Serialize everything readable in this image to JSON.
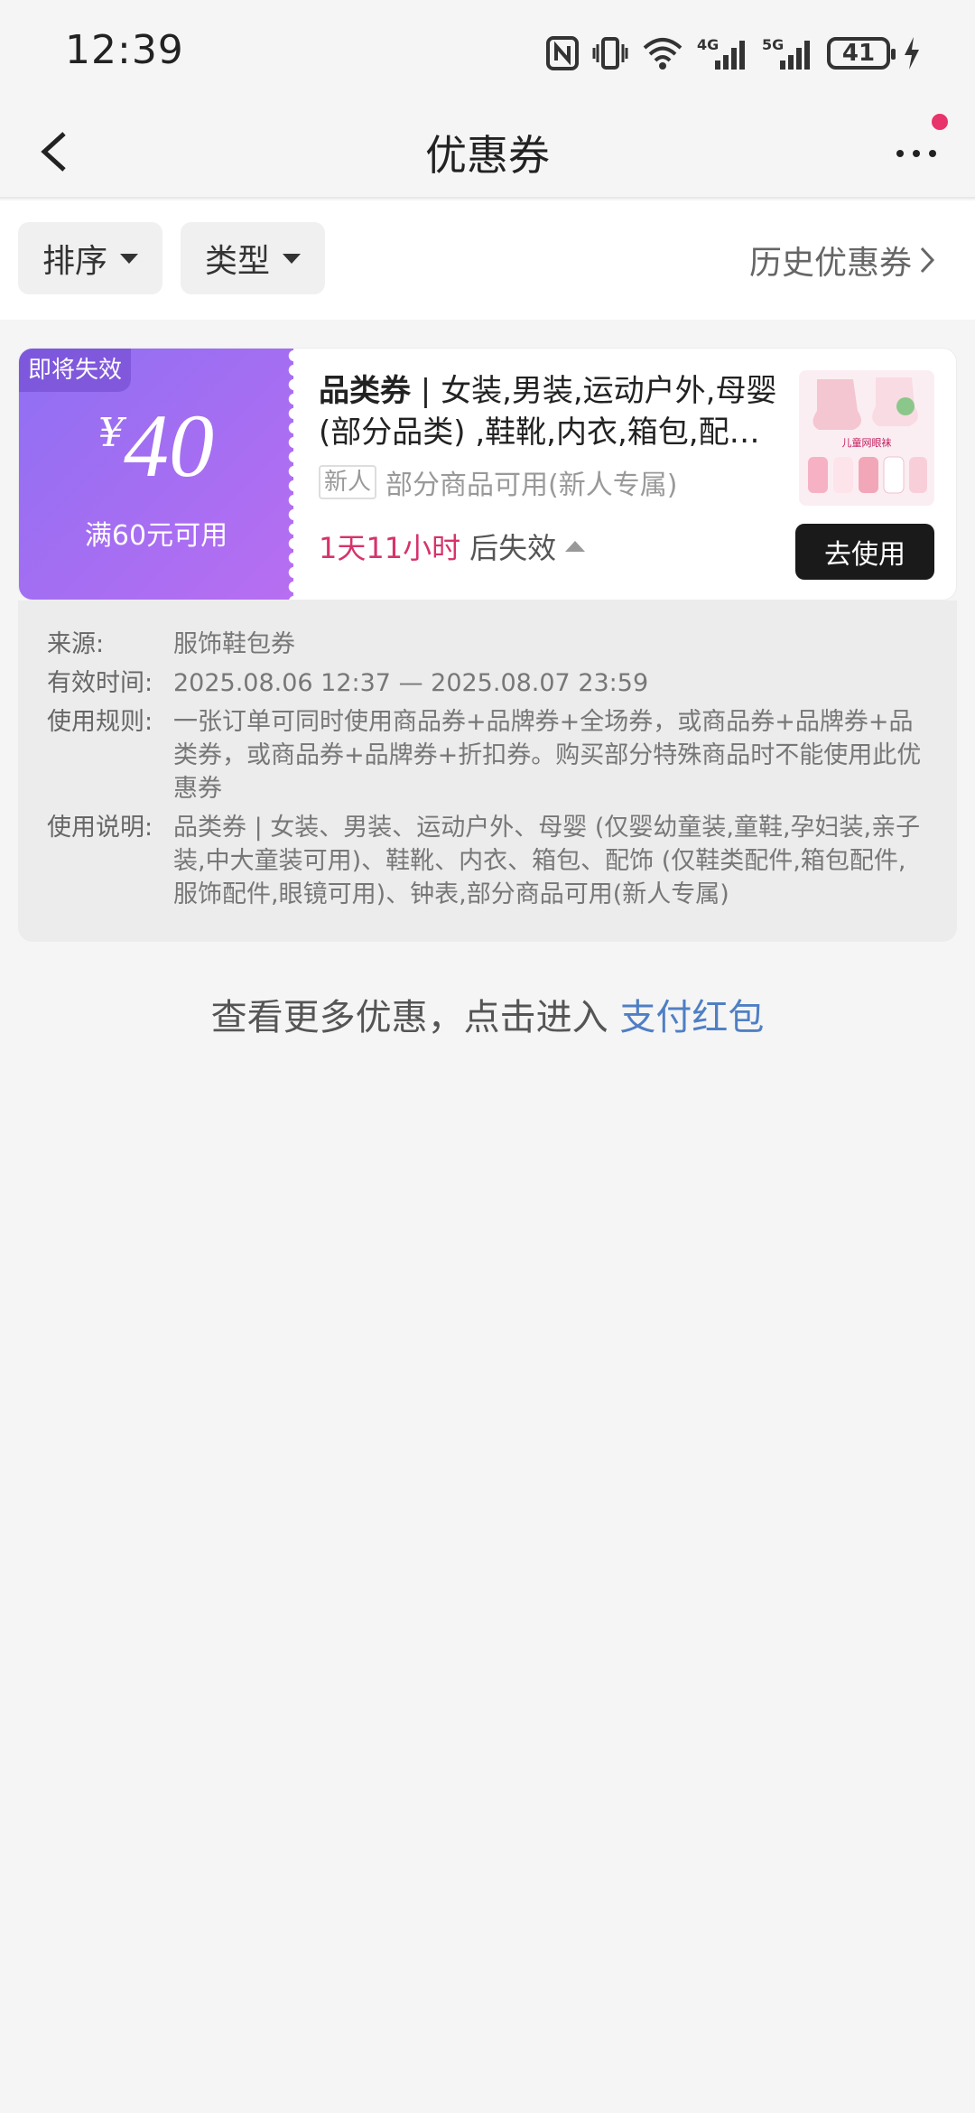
{
  "status_bar": {
    "time": "12:39",
    "battery": "41",
    "net1": "4G",
    "net2": "5G"
  },
  "header": {
    "title": "优惠券"
  },
  "filters": {
    "sort_label": "排序",
    "type_label": "类型",
    "history_label": "历史优惠券"
  },
  "coupon": {
    "badge": "即将失效",
    "currency": "¥",
    "amount": "40",
    "condition": "满60元可用",
    "title_bold": "品类券",
    "title_rest": " | 女装,男装,运动户外,母婴 (部分品类) ,鞋靴,内衣,箱包,配饰,钟表",
    "tag": "新人",
    "tag_text": "部分商品可用(新人专属)",
    "expire_time": "1天11小时",
    "expire_suffix": "后失效",
    "use_button": "去使用",
    "product_image_caption": "儿童网眼袜"
  },
  "details": {
    "source_label": "来源:",
    "source_value": "服饰鞋包券",
    "valid_label": "有效时间:",
    "valid_value": "2025.08.06 12:37 — 2025.08.07 23:59",
    "rule_label": "使用规则:",
    "rule_value": "一张订单可同时使用商品券+品牌券+全场券，或商品券+品牌券+品类券，或商品券+品牌券+折扣券。购买部分特殊商品时不能使用此优惠券",
    "desc_label": "使用说明:",
    "desc_value": "品类券 | 女装、男装、运动户外、母婴 (仅婴幼童装,童鞋,孕妇装,亲子装,中大童装可用)、鞋靴、内衣、箱包、配饰 (仅鞋类配件,箱包配件,服饰配件,眼镜可用)、钟表,部分商品可用(新人专属)"
  },
  "footer": {
    "prefix": "查看更多优惠，点击进入 ",
    "link": "支付红包"
  },
  "colors": {
    "accent_pink": "#d6336c",
    "notification_dot": "#e8336b",
    "coupon_gradient_start": "#8f6ff3",
    "coupon_gradient_end": "#b86ef1",
    "link_blue": "#4f7fc4"
  }
}
